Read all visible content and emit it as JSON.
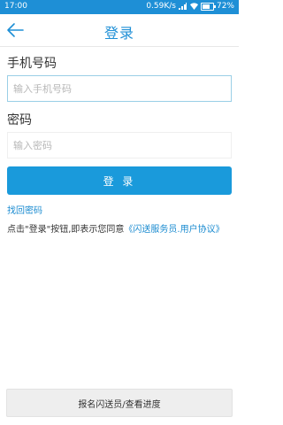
{
  "status_bar": {
    "time": "17:00",
    "speed": "0.59K/s",
    "battery": "72%",
    "battery_level": 0.72,
    "color": "#1e8fd6"
  },
  "header": {
    "title": "登录",
    "back_icon": "arrow-left-icon"
  },
  "form": {
    "phone_label": "手机号码",
    "phone_placeholder": "输入手机号码",
    "phone_value": "",
    "password_label": "密码",
    "password_placeholder": "输入密码",
    "password_value": "",
    "login_button": "登 录",
    "forgot_password": "找回密码",
    "agreement_prefix": "点击\"登录\"按钮,即表示您同意",
    "agreement_link": "《闪送服务员.用户协议》"
  },
  "footer": {
    "register_button": "报名闪送员/查看进度"
  },
  "colors": {
    "accent": "#1a9adb",
    "link": "#1a8bd0",
    "title": "#1e8fd6"
  }
}
